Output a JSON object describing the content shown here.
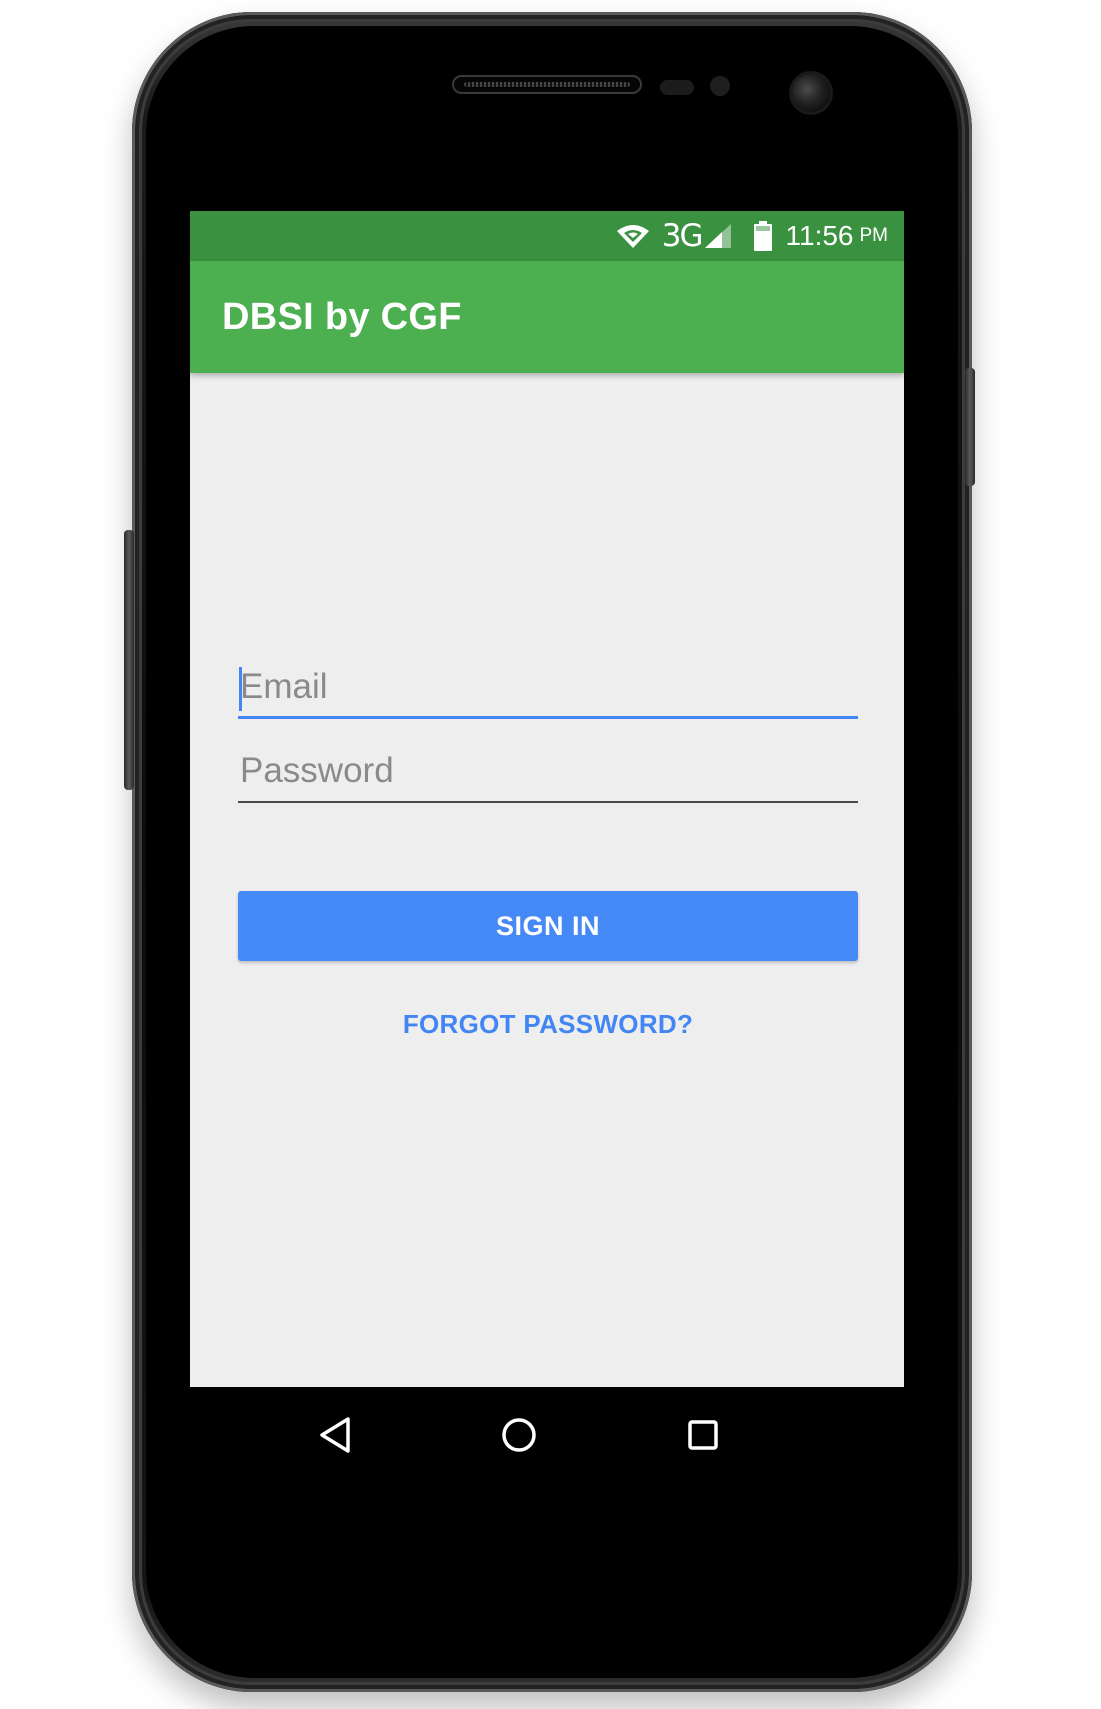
{
  "status_bar": {
    "network_label": "3G",
    "time": "11:56",
    "ampm": "PM",
    "icons": [
      "wifi-icon",
      "cell-signal-icon",
      "battery-icon"
    ],
    "background_color": "#3a9140"
  },
  "app_bar": {
    "title": "DBSI by CGF",
    "background_color": "#4caf50"
  },
  "form": {
    "email": {
      "placeholder": "Email",
      "value": "",
      "focused": true
    },
    "password": {
      "placeholder": "Password",
      "value": ""
    },
    "sign_in_label": "SIGN IN",
    "forgot_password_label": "FORGOT PASSWORD?",
    "accent_color": "#4286f4"
  },
  "nav_bar": {
    "buttons": [
      "back-icon",
      "home-icon",
      "recents-icon"
    ]
  }
}
